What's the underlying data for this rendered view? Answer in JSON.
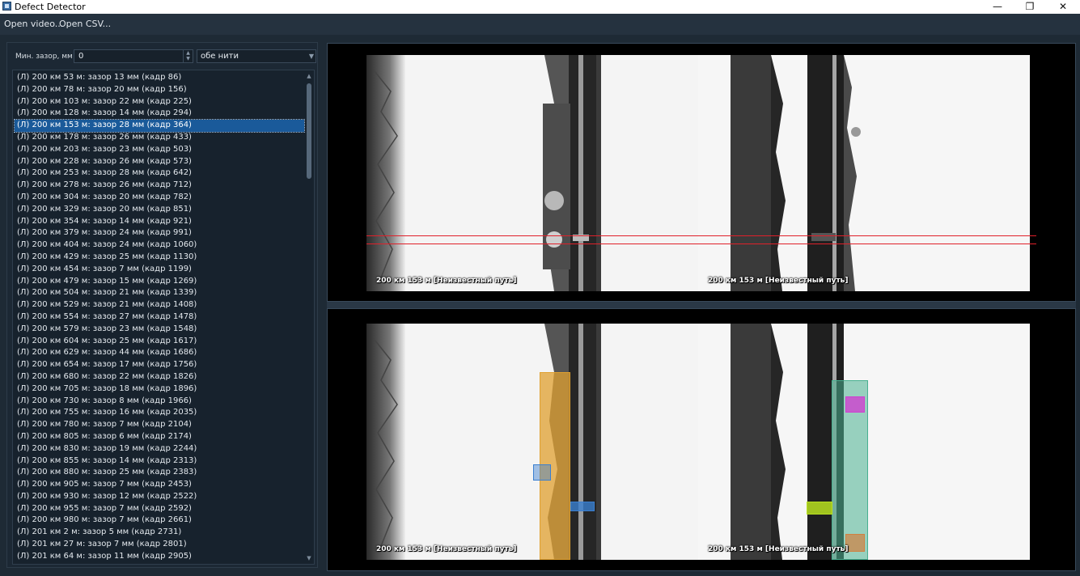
{
  "window": {
    "title": "Defect Detector",
    "minimize": "—",
    "restore": "❐",
    "close": "✕"
  },
  "menu": {
    "open_video": "Open video...",
    "open_csv": "Open CSV..."
  },
  "filter": {
    "min_gap_label": "Мин. зазор, мм",
    "min_gap_value": "0",
    "rail_selection": "обе нити"
  },
  "list": {
    "selected_index": 4,
    "items": [
      "(Л) 200 км 53 м: зазор 13 мм (кадр 86)",
      "(Л) 200 км 78 м: зазор 20 мм (кадр 156)",
      "(Л) 200 км 103 м: зазор 22 мм (кадр 225)",
      "(Л) 200 км 128 м: зазор 14 мм (кадр 294)",
      "(Л) 200 км 153 м: зазор 28 мм (кадр 364)",
      "(Л) 200 км 178 м: зазор 26 мм (кадр 433)",
      "(Л) 200 км 203 м: зазор 23 мм (кадр 503)",
      "(Л) 200 км 228 м: зазор 26 мм (кадр 573)",
      "(Л) 200 км 253 м: зазор 28 мм (кадр 642)",
      "(Л) 200 км 278 м: зазор 26 мм (кадр 712)",
      "(Л) 200 км 304 м: зазор 20 мм (кадр 782)",
      "(Л) 200 км 329 м: зазор 20 мм (кадр 851)",
      "(Л) 200 км 354 м: зазор 14 мм (кадр 921)",
      "(Л) 200 км 379 м: зазор 24 мм (кадр 991)",
      "(Л) 200 км 404 м: зазор 24 мм (кадр 1060)",
      "(Л) 200 км 429 м: зазор 25 мм (кадр 1130)",
      "(Л) 200 км 454 м: зазор 7 мм (кадр 1199)",
      "(Л) 200 км 479 м: зазор 15 мм (кадр 1269)",
      "(Л) 200 км 504 м: зазор 21 мм (кадр 1339)",
      "(Л) 200 км 529 м: зазор 21 мм (кадр 1408)",
      "(Л) 200 км 554 м: зазор 27 мм (кадр 1478)",
      "(Л) 200 км 579 м: зазор 23 мм (кадр 1548)",
      "(Л) 200 км 604 м: зазор 25 мм (кадр 1617)",
      "(Л) 200 км 629 м: зазор 44 мм (кадр 1686)",
      "(Л) 200 км 654 м: зазор 17 мм (кадр 1756)",
      "(Л) 200 км 680 м: зазор 22 мм (кадр 1826)",
      "(Л) 200 км 705 м: зазор 18 мм (кадр 1896)",
      "(Л) 200 км 730 м: зазор 8 мм (кадр 1966)",
      "(Л) 200 км 755 м: зазор 16 мм (кадр 2035)",
      "(Л) 200 км 780 м: зазор 7 мм (кадр 2104)",
      "(Л) 200 км 805 м: зазор 6 мм (кадр 2174)",
      "(Л) 200 км 830 м: зазор 19 мм (кадр 2244)",
      "(Л) 200 км 855 м: зазор 14 мм (кадр 2313)",
      "(Л) 200 км 880 м: зазор 25 мм (кадр 2383)",
      "(Л) 200 км 905 м: зазор 7 мм (кадр 2453)",
      "(Л) 200 км 930 м: зазор 12 мм (кадр 2522)",
      "(Л) 200 км 955 м: зазор 7 мм (кадр 2592)",
      "(Л) 200 км 980 м: зазор 7 мм (кадр 2661)",
      "(Л) 201 км 2 м: зазор 5 мм (кадр 2731)",
      "(Л) 201 км 27 м: зазор 7 мм (кадр 2801)",
      "(Л) 201 км 64 м: зазор 11 мм (кадр 2905)"
    ]
  },
  "frames": {
    "top_left_caption": "200 км 153 м [Неизвестный путь]",
    "top_right_caption": "200 км 153 м [Неизвестный путь]",
    "bottom_left_caption": "200 км 153 м [Неизвестный путь]",
    "bottom_right_caption": "200 км 153 м [Неизвестный путь]",
    "scan_line_color": "#e0202a"
  },
  "detections": {
    "joint_bar_color": "#e0a030",
    "bolt_color": "#3a7fd0",
    "rail_mask_color": "#48b090",
    "clip_color": "#d040d0",
    "fastener_color": "#b8e020",
    "plate_color": "#d08040"
  },
  "icons": [
    "app-icon",
    "minimize-icon",
    "restore-icon",
    "close-icon",
    "spin-up-icon",
    "spin-down-icon",
    "dropdown-arrow-icon",
    "scroll-up-icon",
    "scroll-down-icon"
  ]
}
